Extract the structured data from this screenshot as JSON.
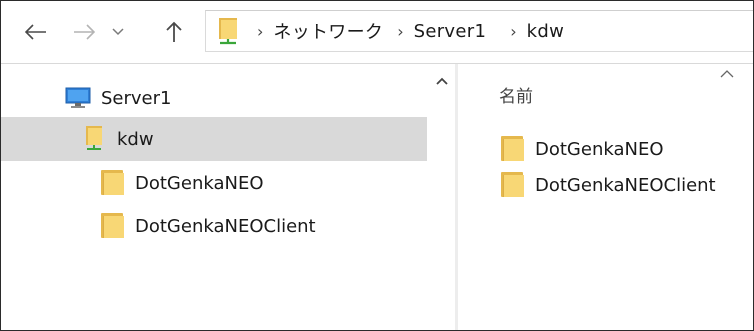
{
  "breadcrumb": {
    "items": [
      "ネットワーク",
      "Server1",
      "kdw"
    ],
    "separator": "›"
  },
  "nav": {
    "tree": [
      {
        "label": "Server1",
        "icon": "computer-icon"
      },
      {
        "label": "kdw",
        "icon": "network-share-icon",
        "selected": true
      },
      {
        "label": "DotGenkaNEO",
        "icon": "folder-icon"
      },
      {
        "label": "DotGenkaNEOClient",
        "icon": "folder-icon"
      }
    ]
  },
  "content": {
    "column_name": "名前",
    "items": [
      {
        "label": "DotGenkaNEO",
        "icon": "folder-icon"
      },
      {
        "label": "DotGenkaNEOClient",
        "icon": "folder-icon"
      }
    ]
  },
  "colors": {
    "selection": "#d9d9d9",
    "folder": "#f8d775",
    "share_cable": "#3aa63a"
  }
}
